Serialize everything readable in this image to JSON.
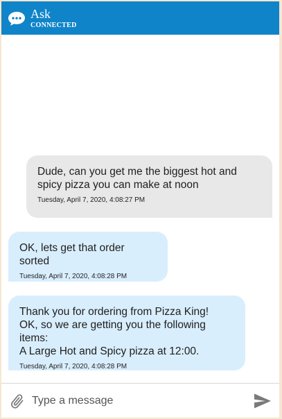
{
  "header": {
    "title": "Ask",
    "status": "CONNECTED",
    "icon": "chat-bubble-icon"
  },
  "messages": [
    {
      "sender": "user",
      "text": "Dude, can you get me the biggest hot and\nspicy pizza you can make at noon",
      "timestamp": "Tuesday, April 7, 2020, 4:08:27 PM"
    },
    {
      "sender": "bot",
      "text": "OK, lets get that order sorted",
      "timestamp": "Tuesday, April 7, 2020, 4:08:28 PM"
    },
    {
      "sender": "bot",
      "text": "Thank you for ordering from Pizza King!\nOK, so we are getting you the following items:\nA Large Hot and Spicy pizza at 12:00.",
      "timestamp": "Tuesday, April 7, 2020, 4:08:28 PM"
    }
  ],
  "composer": {
    "placeholder": "Type a message",
    "value": "",
    "attach_icon": "paperclip-icon",
    "send_icon": "send-icon"
  },
  "colors": {
    "header": "#0f84c9",
    "user_bubble": "#e8e8e8",
    "bot_bubble": "#d9eefd",
    "page_border": "#f6e7d2"
  }
}
